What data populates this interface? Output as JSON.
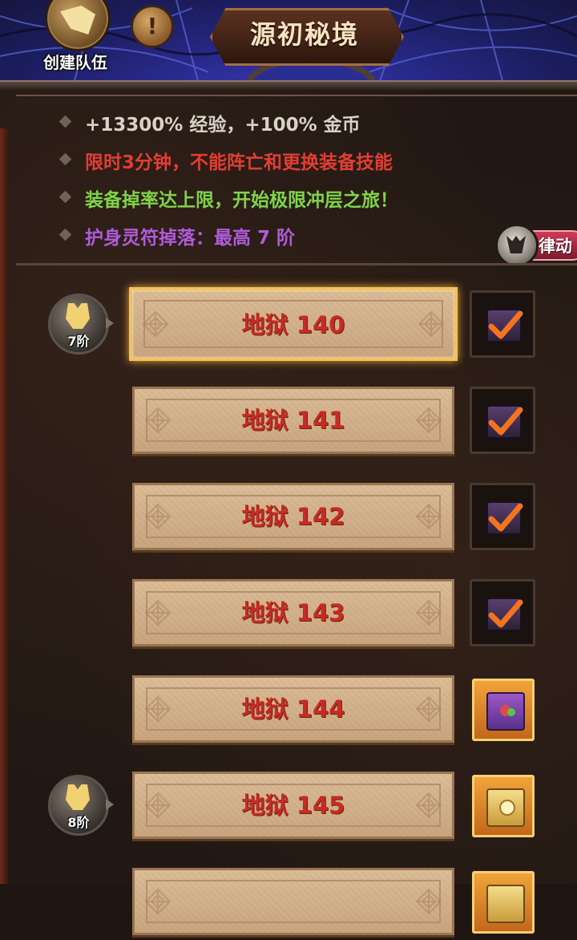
{
  "header": {
    "team_label": "创建队伍",
    "info_label": "!",
    "title": "源初秘境"
  },
  "bonuses": [
    {
      "text": "+13300% 经验，+100% 金币",
      "color": "#d9d2c7"
    },
    {
      "text": "限时3分钟，不能阵亡和更换装备技能",
      "color": "#e23d34"
    },
    {
      "text": "装备掉率达上限，开始极限冲层之旅！",
      "color": "#7fd34a"
    },
    {
      "text": "护身灵符掉落：最高 7 阶",
      "color": "#b05bd8"
    }
  ],
  "rhythm_button": {
    "label": "律动"
  },
  "levels": [
    {
      "label": "地狱 140",
      "selected": true,
      "reward": "done",
      "tier": "7阶"
    },
    {
      "label": "地狱 141",
      "selected": false,
      "reward": "done"
    },
    {
      "label": "地狱 142",
      "selected": false,
      "reward": "done"
    },
    {
      "label": "地狱 143",
      "selected": false,
      "reward": "done"
    },
    {
      "label": "地狱 144",
      "selected": false,
      "reward": "purple-chest"
    },
    {
      "label": "地狱 145",
      "selected": false,
      "reward": "gold-chest",
      "tier": "8阶"
    },
    {
      "label": "",
      "selected": false,
      "reward": "partial"
    }
  ],
  "colors": {
    "level_text": "#c72b22",
    "selected_border": "#f3c15f",
    "check": "#f2741f"
  }
}
